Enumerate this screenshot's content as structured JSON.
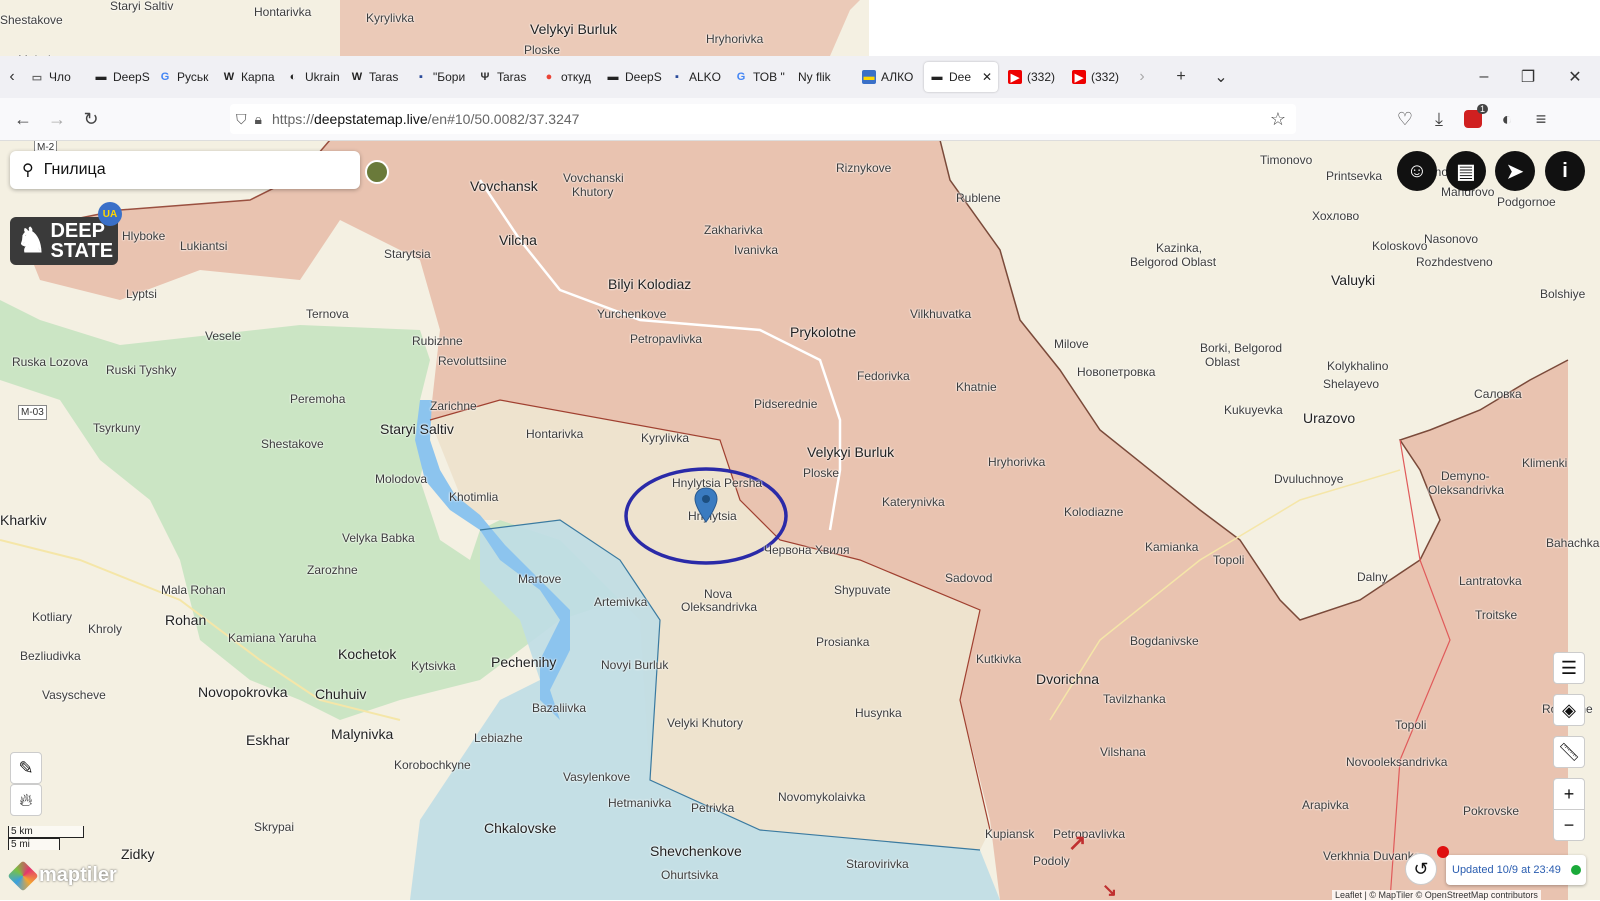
{
  "browser": {
    "tabs": [
      {
        "label": "Чло",
        "icon": "page-icon"
      },
      {
        "label": "DeepS",
        "icon": "deepstate-icon"
      },
      {
        "label": "Руськ",
        "icon": "google-icon"
      },
      {
        "label": "Карпа",
        "icon": "wikipedia-icon"
      },
      {
        "label": "Ukrain",
        "icon": "ukrainer-icon"
      },
      {
        "label": "Taras",
        "icon": "wikipedia-icon"
      },
      {
        "label": "\"Бори",
        "icon": "site-icon"
      },
      {
        "label": "Taras",
        "icon": "trident-icon"
      },
      {
        "label": "откуд",
        "icon": "maps-icon"
      },
      {
        "label": "DeepS",
        "icon": "deepstate-icon"
      },
      {
        "label": "ALKO",
        "icon": "site-icon"
      },
      {
        "label": "ТОВ \"",
        "icon": "google-icon"
      },
      {
        "label": "Ny flik",
        "icon": "none"
      },
      {
        "label": "АЛКО",
        "icon": "flag-icon"
      },
      {
        "label": "Dee",
        "icon": "deepstate-icon",
        "active": true
      },
      {
        "label": "(332)",
        "icon": "youtube-icon"
      },
      {
        "label": "(332)",
        "icon": "youtube-icon"
      }
    ],
    "url_scheme": "https://",
    "url_host": "deepstatemap.live",
    "url_path": "/en#10/50.0082/37.3247",
    "badge_count": "1"
  },
  "search": {
    "value": "Гнилица"
  },
  "logo": {
    "line1": "DEEP",
    "line2": "STATE",
    "ua_badge": "UA"
  },
  "status": {
    "updated": "Updated 10/9 at 23:49"
  },
  "scale": {
    "km": "5 km",
    "mi": "5 mi"
  },
  "attribution": "Leaflet | © MapTiler © OpenStreetMap contributors",
  "brand": "maptiler",
  "map_labels": [
    [
      "Staryi Saltiv",
      110,
      0,
      0
    ],
    [
      "Hontarivka",
      254,
      6,
      0
    ],
    [
      "Kyrylivka",
      366,
      12,
      0
    ],
    [
      "Velykyi Burluk",
      530,
      23,
      1
    ],
    [
      "Hryhorivka",
      706,
      33,
      0
    ],
    [
      "Ploske",
      524,
      44,
      0
    ],
    [
      "Shestakove",
      0,
      14,
      0
    ],
    [
      "Molodova",
      18,
      54,
      0
    ],
    [
      "Vovchansk",
      470,
      180,
      1
    ],
    [
      "Vovchanski",
      563,
      172,
      0
    ],
    [
      "Khutory",
      572,
      186,
      0
    ],
    [
      "Riznykove",
      836,
      162,
      0
    ],
    [
      "Rublene",
      956,
      192,
      0
    ],
    [
      "Timonovo",
      1260,
      154,
      0
    ],
    [
      "Printsevka",
      1326,
      170,
      0
    ],
    [
      "Selivanovo",
      1402,
      166,
      0
    ],
    [
      "Mandrovo",
      1441,
      186,
      0
    ],
    [
      "Podgornoe",
      1497,
      196,
      0
    ],
    [
      "Хохлово",
      1312,
      210,
      0
    ],
    [
      "Vilcha",
      499,
      234,
      1
    ],
    [
      "Zakharivka",
      704,
      224,
      0
    ],
    [
      "Ivanivka",
      734,
      244,
      0
    ],
    [
      "Kazinka,",
      1156,
      242,
      0
    ],
    [
      "Belgorod Oblast",
      1130,
      256,
      0
    ],
    [
      "Koloskovo",
      1372,
      240,
      0
    ],
    [
      "Nasonovo",
      1424,
      233,
      0
    ],
    [
      "Rozhdestveno",
      1416,
      256,
      0
    ],
    [
      "Hlyboke",
      122,
      230,
      0
    ],
    [
      "Lukiantsi",
      180,
      240,
      0
    ],
    [
      "Starytsia",
      384,
      248,
      0
    ],
    [
      "Valuyki",
      1331,
      274,
      1
    ],
    [
      "Bilyi Kolodiaz",
      608,
      278,
      1
    ],
    [
      "Bolshiye",
      1540,
      288,
      0
    ],
    [
      "Lyptsi",
      126,
      288,
      0
    ],
    [
      "Yurchenkove",
      597,
      308,
      0
    ],
    [
      "Ternova",
      306,
      308,
      0
    ],
    [
      "Vilkhuvatka",
      910,
      308,
      0
    ],
    [
      "Prykolotne",
      790,
      326,
      1
    ],
    [
      "Vesele",
      205,
      330,
      0
    ],
    [
      "Rubizhne",
      412,
      335,
      0
    ],
    [
      "Petropavlivka",
      630,
      333,
      0
    ],
    [
      "Milove",
      1054,
      338,
      0
    ],
    [
      "Borki, Belgorod",
      1200,
      342,
      0
    ],
    [
      "Oblast",
      1205,
      356,
      0
    ],
    [
      "Ruska Lozova",
      12,
      356,
      0
    ],
    [
      "Revoluttsiine",
      438,
      355,
      0
    ],
    [
      "Kolykhalino",
      1327,
      360,
      0
    ],
    [
      "Ruski Tyshky",
      106,
      364,
      0
    ],
    [
      "Fedorivka",
      857,
      370,
      0
    ],
    [
      "Новопетровка",
      1077,
      366,
      0
    ],
    [
      "Shelayevo",
      1323,
      378,
      0
    ],
    [
      "Khatnie",
      956,
      381,
      0
    ],
    [
      "Peremoha",
      290,
      393,
      0
    ],
    [
      "Салoвка",
      1474,
      388,
      0
    ],
    [
      "Pidserednie",
      754,
      398,
      0
    ],
    [
      "Zarichne",
      430,
      400,
      0
    ],
    [
      "Kukuyevka",
      1224,
      404,
      0
    ],
    [
      "Urazovo",
      1303,
      412,
      1
    ],
    [
      "Tsyrkuny",
      93,
      422,
      0
    ],
    [
      "Staryi Saltiv",
      380,
      423,
      1
    ],
    [
      "Hontarivka",
      526,
      428,
      0
    ],
    [
      "Kyrylivka",
      641,
      432,
      0
    ],
    [
      "Shestakove",
      261,
      438,
      0
    ],
    [
      "Velykyi Burluk",
      807,
      446,
      1
    ],
    [
      "Hryhorivka",
      988,
      456,
      0
    ],
    [
      "Klimenki",
      1522,
      457,
      0
    ],
    [
      "Demyno-",
      1441,
      470,
      0
    ],
    [
      "Ploske",
      803,
      467,
      0
    ],
    [
      "Molodova",
      375,
      473,
      0
    ],
    [
      "Dvuluchnoye",
      1274,
      473,
      0
    ],
    [
      "Hnylytsia Persha",
      672,
      477,
      0
    ],
    [
      "Oleksandrivka",
      1428,
      484,
      0
    ],
    [
      "Khotimlia",
      449,
      491,
      0
    ],
    [
      "Katerynivka",
      882,
      496,
      0
    ],
    [
      "Hnylytsia",
      688,
      510,
      0
    ],
    [
      "Kolodiazne",
      1064,
      506,
      0
    ],
    [
      "Kharkiv",
      0,
      514,
      1
    ],
    [
      "Velyka Babka",
      342,
      532,
      0
    ],
    [
      "Kamianka",
      1145,
      541,
      0
    ],
    [
      "Bahachka",
      1546,
      537,
      0
    ],
    [
      "Червона Хвиля",
      764,
      544,
      0
    ],
    [
      "Topoli",
      1213,
      554,
      0
    ],
    [
      "Zarozhne",
      307,
      564,
      0
    ],
    [
      "Sadovod",
      945,
      572,
      0
    ],
    [
      "Martove",
      518,
      573,
      0
    ],
    [
      "Dalny",
      1357,
      571,
      0
    ],
    [
      "Lantratovka",
      1459,
      575,
      0
    ],
    [
      "Nova",
      704,
      588,
      0
    ],
    [
      "Mala Rohan",
      161,
      584,
      0
    ],
    [
      "Shypuvate",
      834,
      584,
      0
    ],
    [
      "Artemivka",
      594,
      596,
      0
    ],
    [
      "Oleksandrivka",
      681,
      601,
      0
    ],
    [
      "Kotliary",
      32,
      611,
      0
    ],
    [
      "Troitske",
      1475,
      609,
      0
    ],
    [
      "Rohan",
      165,
      614,
      1
    ],
    [
      "Khroly",
      88,
      623,
      0
    ],
    [
      "Prosianka",
      816,
      636,
      0
    ],
    [
      "Bogdanivske",
      1130,
      635,
      0
    ],
    [
      "Kamiana Yaruha",
      228,
      632,
      0
    ],
    [
      "Kochetok",
      338,
      648,
      1
    ],
    [
      "Bezliudivka",
      20,
      650,
      0
    ],
    [
      "Kytsivka",
      411,
      660,
      0
    ],
    [
      "Pechenihy",
      491,
      656,
      1
    ],
    [
      "Novyi Burluk",
      601,
      659,
      0
    ],
    [
      "Kutkivka",
      976,
      653,
      0
    ],
    [
      "Dvorichna",
      1036,
      673,
      1
    ],
    [
      "Novopokrovka",
      198,
      686,
      1
    ],
    [
      "Chuhuiv",
      315,
      688,
      1
    ],
    [
      "Vasyscheve",
      42,
      689,
      0
    ],
    [
      "Tavilzhanka",
      1103,
      693,
      0
    ],
    [
      "Rozdolne",
      1542,
      703,
      0
    ],
    [
      "Bazaliivka",
      532,
      702,
      0
    ],
    [
      "Husynka",
      855,
      707,
      0
    ],
    [
      "Topoli",
      1395,
      719,
      0
    ],
    [
      "Velyki Khutory",
      667,
      717,
      0
    ],
    [
      "Malynivka",
      331,
      728,
      1
    ],
    [
      "Lebiazhe",
      474,
      732,
      0
    ],
    [
      "Eskhar",
      246,
      734,
      1
    ],
    [
      "Vilshana",
      1100,
      746,
      0
    ],
    [
      "Novooleksandrivka",
      1346,
      756,
      0
    ],
    [
      "Korobochkyne",
      394,
      759,
      0
    ],
    [
      "Vasylenkove",
      563,
      771,
      0
    ],
    [
      "Novomykolaivka",
      778,
      791,
      0
    ],
    [
      "Arapivka",
      1302,
      799,
      0
    ],
    [
      "Hetmanivka",
      608,
      797,
      0
    ],
    [
      "Petrivka",
      691,
      802,
      0
    ],
    [
      "Pokrovske",
      1463,
      805,
      0
    ],
    [
      "Skrypai",
      254,
      821,
      0
    ],
    [
      "Chkalovske",
      484,
      822,
      1
    ],
    [
      "Kupiansk",
      985,
      828,
      0
    ],
    [
      "Petropavlivka",
      1053,
      828,
      0
    ],
    [
      "Shevchenkove",
      650,
      845,
      1
    ],
    [
      "Zidky",
      121,
      848,
      1
    ],
    [
      "Verkhnia Duvanka",
      1323,
      850,
      0
    ],
    [
      "Starovirivka",
      846,
      858,
      0
    ],
    [
      "Podoly",
      1033,
      855,
      0
    ],
    [
      "Ohurtsivka",
      661,
      869,
      0
    ]
  ],
  "road_labels": [
    [
      "M-2",
      34,
      140
    ],
    [
      "M-03",
      18,
      405
    ]
  ]
}
